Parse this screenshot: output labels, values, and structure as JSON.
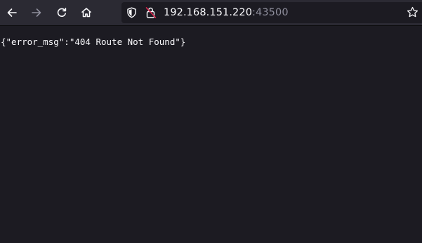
{
  "toolbar": {
    "back_icon": "arrow-left-icon",
    "forward_icon": "arrow-right-icon",
    "forward_enabled": false,
    "reload_icon": "reload-icon",
    "home_icon": "home-icon"
  },
  "urlbar": {
    "host": "192.168.151.220",
    "port": ":43500",
    "shield_icon": "shield-icon",
    "lock_icon": "insecure-lock-icon",
    "bookmark_icon": "star-icon"
  },
  "page": {
    "body_text": "{\"error_msg\":\"404 Route Not Found\"}"
  },
  "colors": {
    "toolbar_bg": "#2b2a33",
    "content_bg": "#1c1b22",
    "text": "#fbfbfe",
    "port_text": "#8f8f9d",
    "insecure_accent": "#e22850"
  }
}
